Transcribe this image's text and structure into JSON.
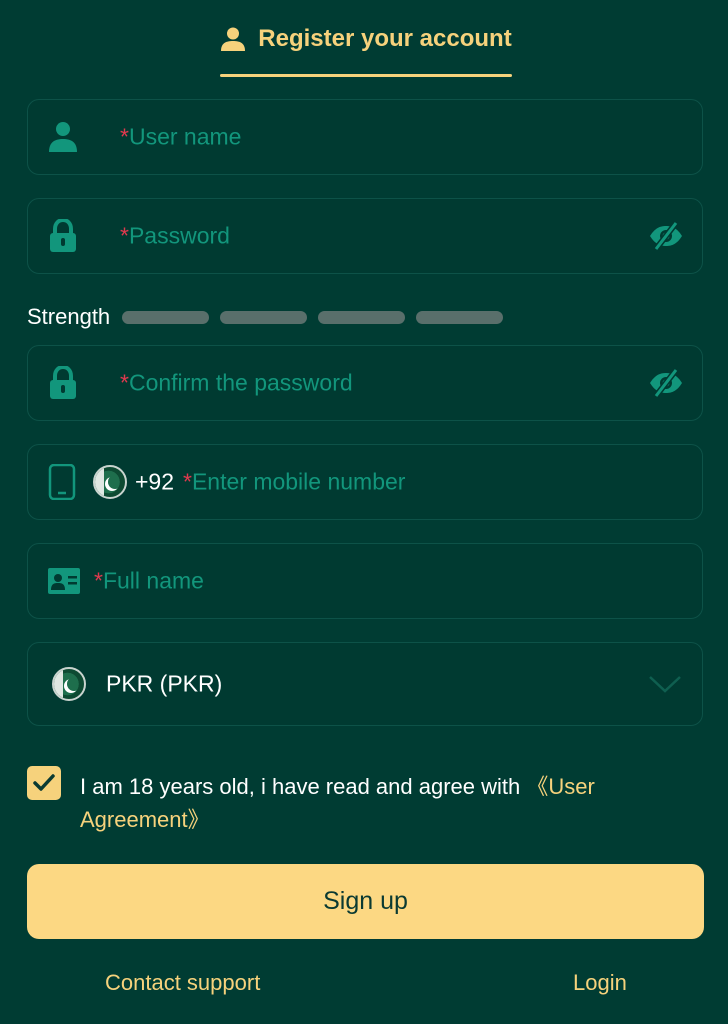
{
  "header": {
    "title": "Register your account"
  },
  "form": {
    "username": {
      "required_mark": "*",
      "placeholder": "User name"
    },
    "password": {
      "required_mark": "*",
      "placeholder": "Password"
    },
    "strength": {
      "label": "Strength"
    },
    "confirm_password": {
      "required_mark": "*",
      "placeholder": "Confirm the password"
    },
    "mobile": {
      "country_code": "+92",
      "required_mark": "*",
      "placeholder": "Enter mobile number"
    },
    "full_name": {
      "required_mark": "*",
      "placeholder": "Full name"
    },
    "currency": {
      "value": "PKR (PKR)"
    }
  },
  "agreement": {
    "checked": true,
    "text": "I am 18 years old, i have read and agree with ",
    "link": "《User Agreement》"
  },
  "actions": {
    "signup_label": "Sign up"
  },
  "footer": {
    "contact_support": "Contact support",
    "login": "Login"
  },
  "colors": {
    "background": "#003c33",
    "accent": "#f6d27c",
    "placeholder": "#12967c",
    "required": "#e0394e",
    "button": "#fcd883"
  }
}
